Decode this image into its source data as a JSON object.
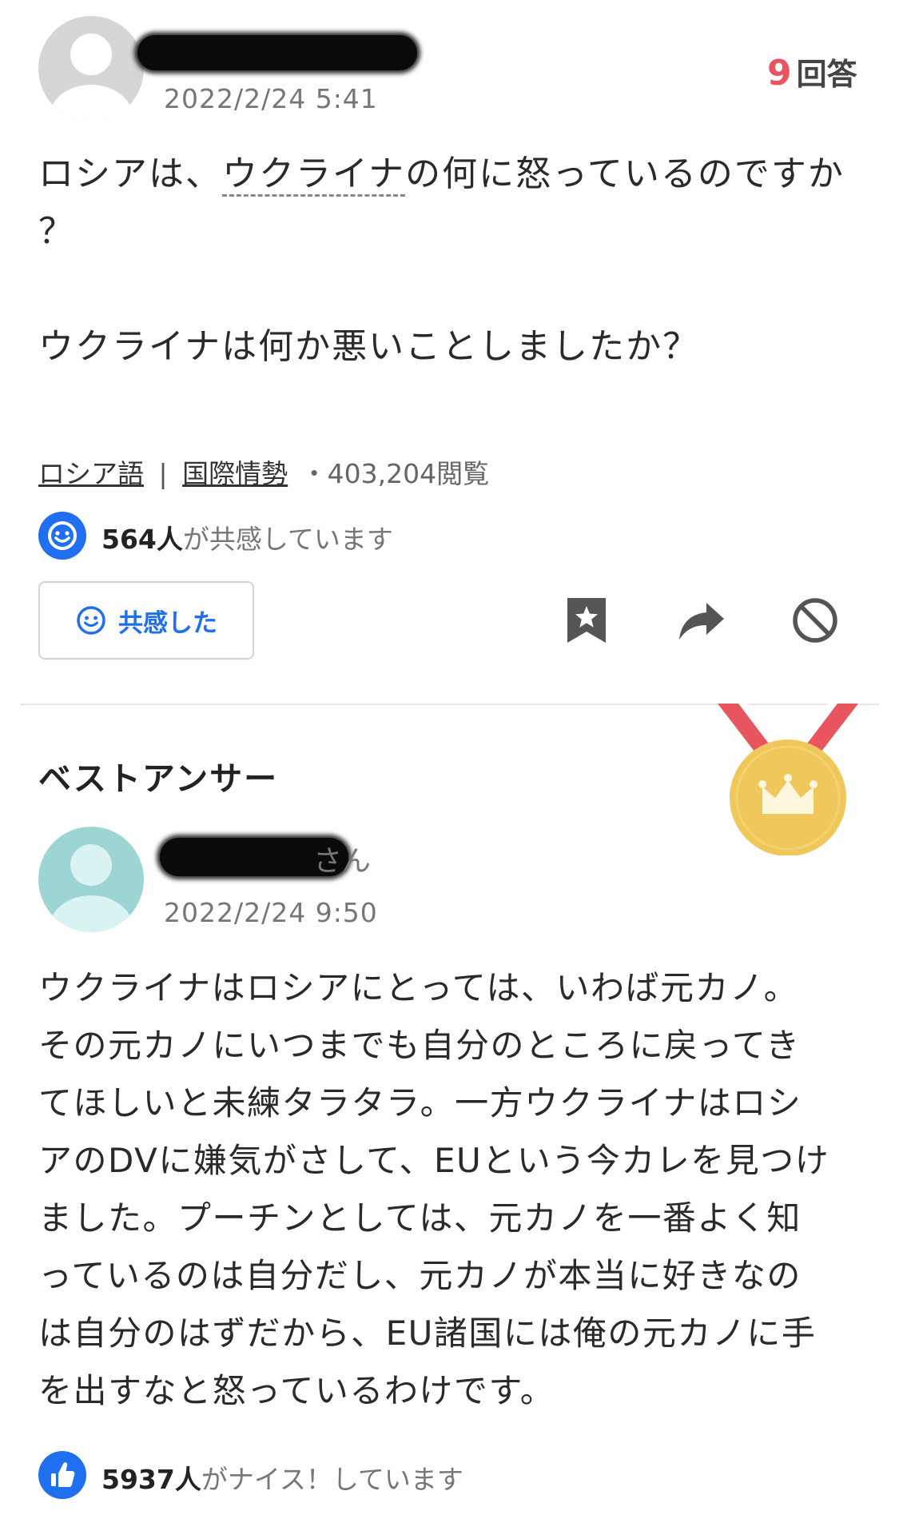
{
  "question": {
    "date": "2022/2/24 5:41",
    "answer_count": "9",
    "answer_count_label": "回答",
    "text_line1_pre": "ロシアは、",
    "text_link": "ウクライナ",
    "text_line1_post": "の何に怒っているのですか",
    "text_line2": "？",
    "text_line3": "ウクライナは何か悪いことしましたか？",
    "category1": "ロシア語",
    "separator": "|",
    "category2": "国際情勢",
    "views": "・403,204閲覧",
    "empathy_count": "564人",
    "empathy_suffix": "が共感しています",
    "empathy_button_label": "共感した"
  },
  "best_answer": {
    "heading": "ベストアンサー",
    "user_suffix": "さん",
    "date": "2022/2/24 9:50",
    "lines": [
      "ウクライナはロシアにとっては、いわば元カノ。",
      "その元カノにいつまでも自分のところに戻ってき",
      "てほしいと未練タラタラ。一方ウクライナはロシ",
      "アのDVに嫌気がさして、EUという今カレを見つけ",
      "ました。プーチンとしては、元カノを一番よく知",
      "っているのは自分だし、元カノが本当に好きなの",
      "は自分のはずだから、EU諸国には俺の元カノに手",
      "を出すなと怒っているわけです。"
    ],
    "nice_count": "5937人",
    "nice_suffix": "がナイス！しています"
  },
  "icons": {
    "empathy": "smile-icon",
    "bookmark": "bookmark-star-icon",
    "share": "share-arrow-icon",
    "block": "block-icon",
    "medal": "gold-medal-crown-icon",
    "thumbs_up": "thumbs-up-icon"
  },
  "colors": {
    "accent_blue": "#1f6ff0",
    "answer_count_red": "#e8555f",
    "medal_gold": "#f0c75a",
    "ribbon_red": "#e8555f"
  }
}
